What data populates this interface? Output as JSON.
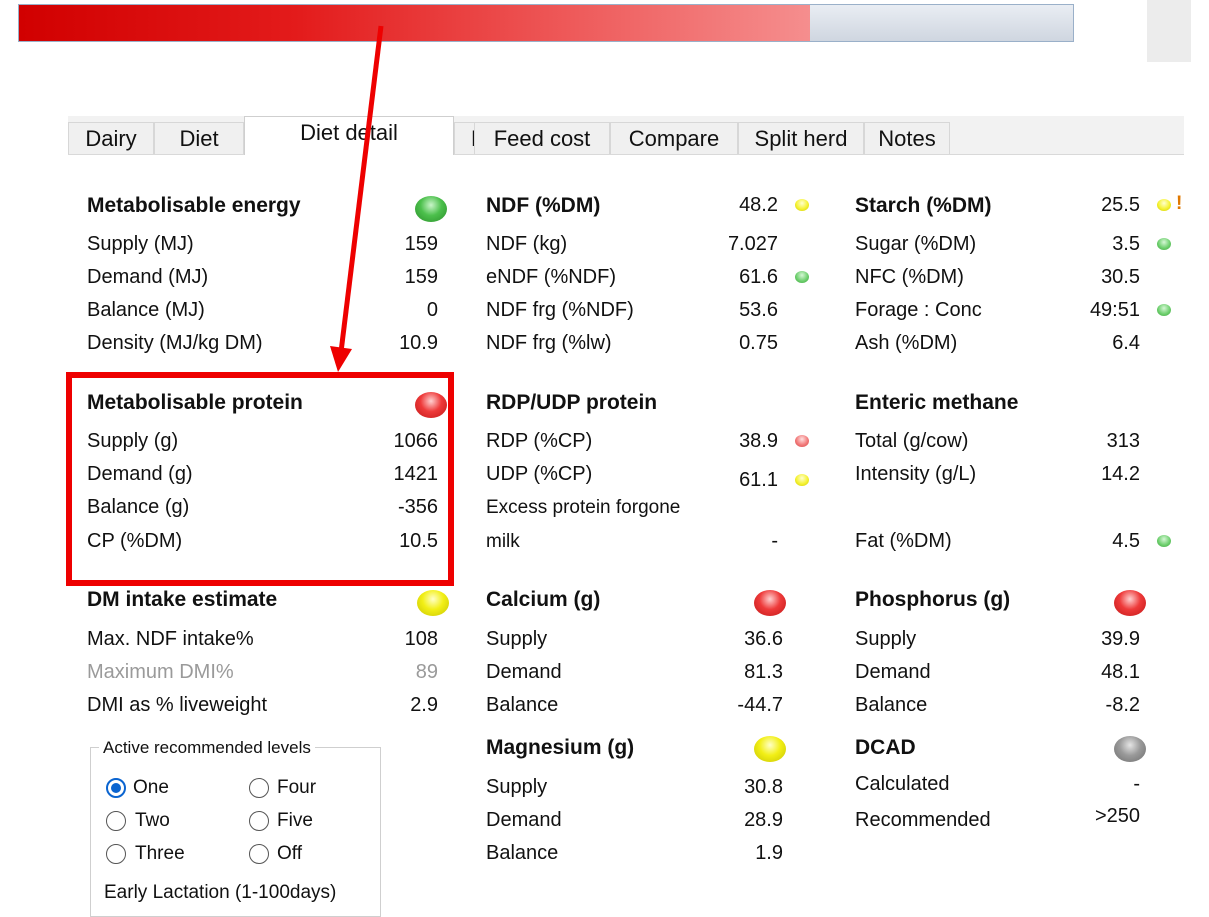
{
  "progress": {
    "fill_fraction": 0.75
  },
  "tabs": [
    {
      "label": "Dairy",
      "active": false
    },
    {
      "label": "Diet",
      "active": false
    },
    {
      "label": "Diet detail",
      "active": true
    },
    {
      "label": "Price",
      "active": false
    },
    {
      "label": "Feed cost",
      "active": false
    },
    {
      "label": "Compare",
      "active": false
    },
    {
      "label": "Split herd",
      "active": false
    },
    {
      "label": "Notes",
      "active": false
    }
  ],
  "metabolisable_energy": {
    "title": "Metabolisable energy",
    "status": "green",
    "rows": [
      {
        "label": "Supply (MJ)",
        "value": "159"
      },
      {
        "label": "Demand (MJ)",
        "value": "159"
      },
      {
        "label": "Balance (MJ)",
        "value": "0"
      },
      {
        "label": "Density (MJ/kg DM)",
        "value": "10.9"
      }
    ]
  },
  "metabolisable_protein": {
    "title": "Metabolisable protein",
    "status": "red",
    "rows": [
      {
        "label": "Supply (g)",
        "value": "1066"
      },
      {
        "label": "Demand (g)",
        "value": "1421"
      },
      {
        "label": "Balance (g)",
        "value": "-356"
      },
      {
        "label": "CP (%DM)",
        "value": "10.5"
      }
    ]
  },
  "dm_intake": {
    "title": "DM intake estimate",
    "status": "yellow",
    "rows": [
      {
        "label": "Max. NDF intake%",
        "value": "108"
      },
      {
        "label": "Maximum DMI%",
        "value": "89"
      },
      {
        "label": "DMI as % liveweight",
        "value": "2.9"
      }
    ]
  },
  "ndf": {
    "title": "NDF (%DM)",
    "title_value": "48.2",
    "title_status": "yellow",
    "rows": [
      {
        "label": "NDF (kg)",
        "value": "7.027",
        "status": ""
      },
      {
        "label": "eNDF (%NDF)",
        "value": "61.6",
        "status": "green"
      },
      {
        "label": "NDF frg (%NDF)",
        "value": "53.6",
        "status": ""
      },
      {
        "label": "NDF frg (%lw)",
        "value": "0.75",
        "status": ""
      }
    ]
  },
  "rdp_udp": {
    "title": "RDP/UDP protein",
    "rows": [
      {
        "label": "RDP (%CP)",
        "value": "38.9",
        "status": "red"
      },
      {
        "label": "UDP (%CP)",
        "value": "61.1",
        "status": "yellow"
      }
    ],
    "excess_label_1": "Excess protein forgone",
    "excess_label_2": "milk",
    "excess_value": "-"
  },
  "calcium": {
    "title": "Calcium (g)",
    "status": "red",
    "rows": [
      {
        "label": "Supply",
        "value": "36.6"
      },
      {
        "label": "Demand",
        "value": "81.3"
      },
      {
        "label": "Balance",
        "value": "-44.7"
      }
    ]
  },
  "magnesium": {
    "title": "Magnesium (g)",
    "status": "yellow",
    "rows": [
      {
        "label": "Supply",
        "value": "30.8"
      },
      {
        "label": "Demand",
        "value": "28.9"
      },
      {
        "label": "Balance",
        "value": "1.9"
      }
    ]
  },
  "starch": {
    "title": "Starch (%DM)",
    "title_value": "25.5",
    "title_status": "yellow",
    "title_flag": "!",
    "rows": [
      {
        "label": "Sugar (%DM)",
        "value": "3.5",
        "status": "green"
      },
      {
        "label": "NFC (%DM)",
        "value": "30.5",
        "status": ""
      },
      {
        "label": "Forage : Conc",
        "value": "49:51",
        "status": "green"
      },
      {
        "label": "Ash (%DM)",
        "value": "6.4",
        "status": ""
      }
    ]
  },
  "enteric_methane": {
    "title": "Enteric methane",
    "rows": [
      {
        "label": "Total (g/cow)",
        "value": "313"
      },
      {
        "label": "Intensity (g/L)",
        "value": "14.2"
      }
    ]
  },
  "fat": {
    "label": "Fat (%DM)",
    "value": "4.5",
    "status": "green"
  },
  "phosphorus": {
    "title": "Phosphorus (g)",
    "status": "red",
    "rows": [
      {
        "label": "Supply",
        "value": "39.9"
      },
      {
        "label": "Demand",
        "value": "48.1"
      },
      {
        "label": "Balance",
        "value": "-8.2"
      }
    ]
  },
  "dcad": {
    "title": "DCAD",
    "status": "grey",
    "rows": [
      {
        "label": "Calculated",
        "value": "-"
      },
      {
        "label": "Recommended",
        "value": ">250"
      }
    ]
  },
  "levels": {
    "legend": "Active recommended levels",
    "options": [
      {
        "label": "One",
        "checked": true
      },
      {
        "label": "Four",
        "checked": false
      },
      {
        "label": "Two",
        "checked": false
      },
      {
        "label": "Five",
        "checked": false
      },
      {
        "label": "Three",
        "checked": false
      },
      {
        "label": "Off",
        "checked": false
      }
    ],
    "stage": "Early Lactation (1-100days)"
  }
}
